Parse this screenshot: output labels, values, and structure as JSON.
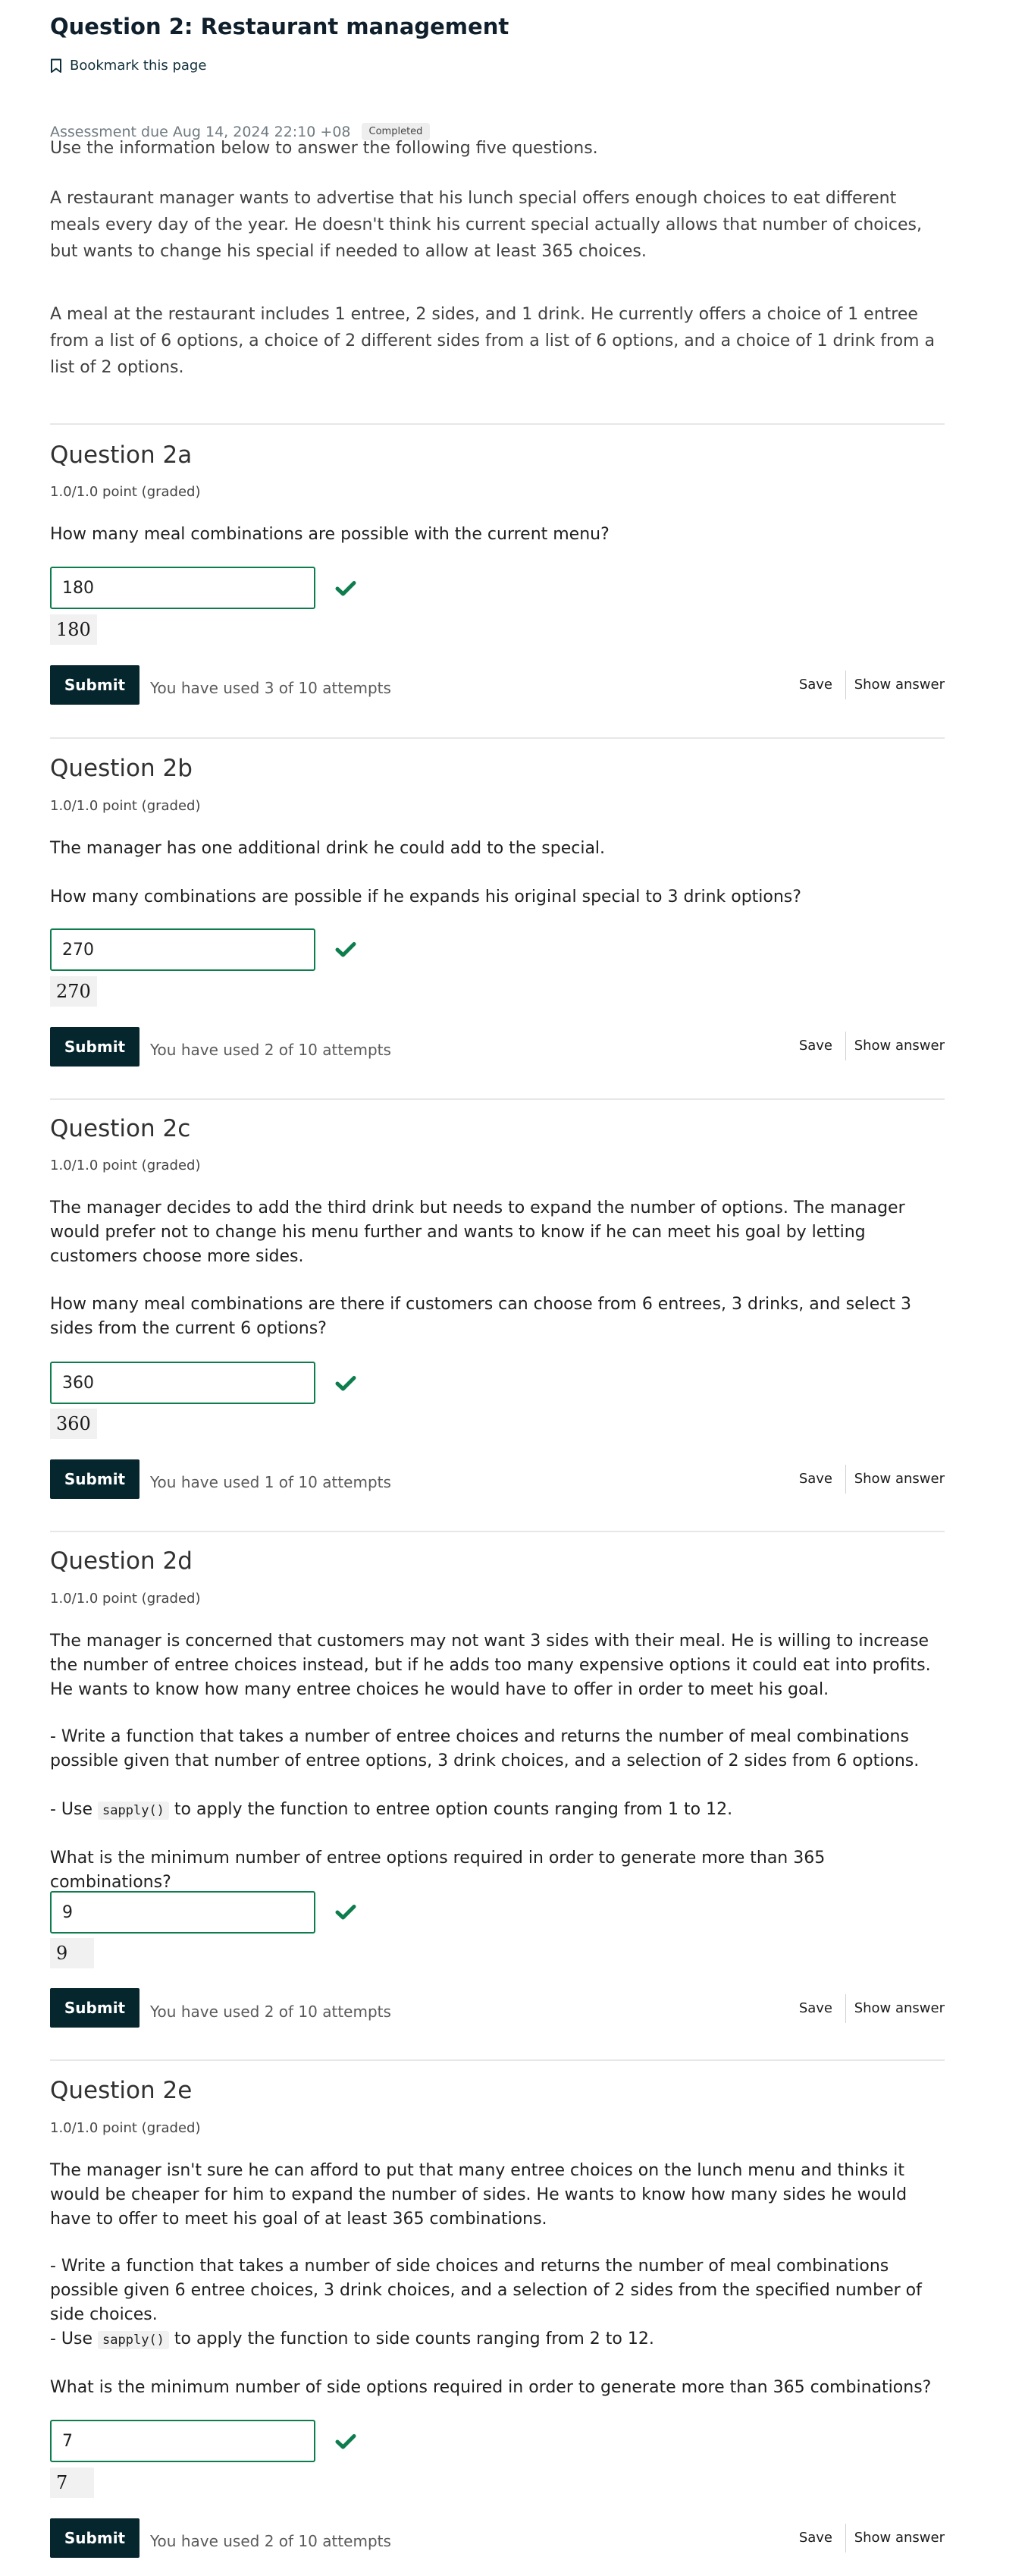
{
  "unit": {
    "title": "Question 2: Restaurant management",
    "bookmark_label": "Bookmark this page",
    "due": "Assessment due Aug 14, 2024 22:10 +08",
    "status_badge": "Completed"
  },
  "intro": {
    "p1": "Use the information below to answer the following five questions.",
    "p2": "A restaurant manager wants to advertise that his lunch special offers enough choices to eat different meals every day of the year. He doesn't think his current special actually allows that number of choices, but wants to change his special if needed to allow at least 365 choices.",
    "p3": "A meal at the restaurant includes 1 entree, 2 sides, and 1 drink. He currently offers a choice of 1 entree from a list of 6 options, a choice of 2 different sides from a list of 6 options, and a choice of 1 drink from a list of 2 options."
  },
  "common": {
    "submit_label": "Submit",
    "save_label": "Save",
    "show_answer_label": "Show answer",
    "check_color": "#0d7d4d",
    "submit_bg": "#06262e"
  },
  "questions": [
    {
      "title": "Question 2a",
      "points": "1.0/1.0 point (graded)",
      "prompt": "How many meal combinations are possible with the current menu?",
      "answer": "180",
      "preview": "180",
      "attempts": "You have used 3 of 10 attempts"
    },
    {
      "title": "Question 2b",
      "points": "1.0/1.0 point (graded)",
      "context": "The manager has one additional drink he could add to the special.",
      "prompt": "How many combinations are possible if he expands his original special to 3 drink options?",
      "answer": "270",
      "preview": "270",
      "attempts": "You have used 2 of 10 attempts"
    },
    {
      "title": "Question 2c",
      "points": "1.0/1.0 point (graded)",
      "context": "The manager decides to add the third drink but needs to expand the number of options. The manager would prefer not to change his menu further and wants to know if he can meet his goal by letting customers choose more sides.",
      "prompt": "How many meal combinations are there if customers can choose from 6 entrees, 3 drinks, and select 3 sides from the current 6 options?",
      "answer": "360",
      "preview": "360",
      "attempts": "You have used 1 of 10 attempts"
    },
    {
      "title": "Question 2d",
      "points": "1.0/1.0 point (graded)",
      "context": "The manager is concerned that customers may not want 3 sides with their meal. He is willing to increase the number of entree choices instead, but if he adds too many expensive options it could eat into profits. He wants to know how many entree choices he would have to offer in order to meet his goal.",
      "bullet1": "- Write a function that takes a number of entree choices and returns the number of meal combinations possible given that number of entree options, 3 drink choices, and a selection of 2 sides from 6 options.",
      "bullet2_pre": "- Use",
      "bullet2_code": "sapply()",
      "bullet2_post": "to apply the function to entree option counts ranging from 1 to 12.",
      "prompt": "What is the minimum number of entree options required in order to generate more than 365 combinations?",
      "answer": "9",
      "preview": "9",
      "attempts": "You have used 2 of 10 attempts"
    },
    {
      "title": "Question 2e",
      "points": "1.0/1.0 point (graded)",
      "context": "The manager isn't sure he can afford to put that many entree choices on the lunch menu and thinks it would be cheaper for him to expand the number of sides. He wants to know how many sides he would have to offer to meet his goal of at least 365 combinations.",
      "bullet1": "- Write a function that takes a number of side choices and returns the number of meal combinations possible given 6 entree choices, 3 drink choices, and a selection of 2 sides from the specified number of side choices.",
      "bullet2_pre": "- Use",
      "bullet2_code": "sapply()",
      "bullet2_post": "to apply the function to side counts ranging from 2 to 12.",
      "prompt": "What is the minimum number of side options required in order to generate more than 365 combinations?",
      "answer": "7",
      "preview": "7",
      "attempts": "You have used 2 of 10 attempts"
    }
  ]
}
